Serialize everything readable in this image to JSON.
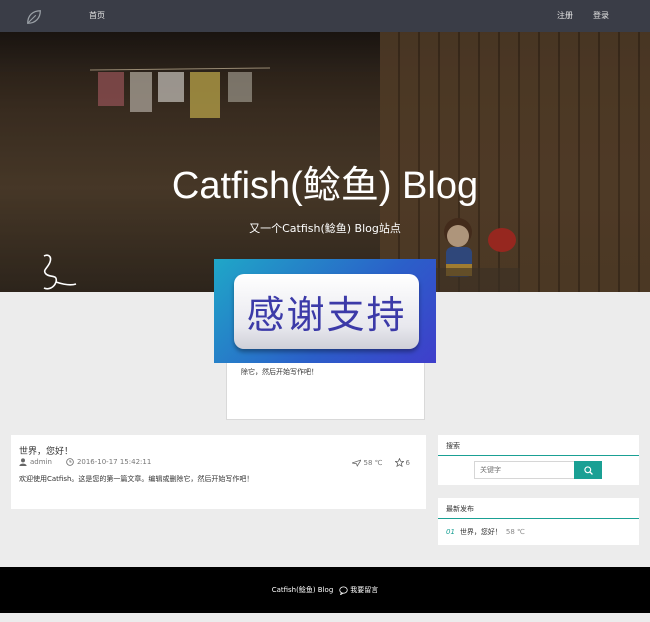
{
  "nav": {
    "home_label": "首页",
    "register_label": "注册",
    "login_label": "登录"
  },
  "hero": {
    "title": "Catfish(鲶鱼) Blog",
    "subtitle": "又一个Catfish(鲶鱼) Blog站点"
  },
  "banner": {
    "text": "感谢支持"
  },
  "popup": {
    "text": "除它，然后开始写作吧！"
  },
  "post": {
    "title": "世界，您好！",
    "author": "admin",
    "date": "2016-10-17 15:42:11",
    "views": "58 ℃",
    "favorites": "6",
    "excerpt": "欢迎使用Catfish。这是您的第一篇文章。编辑或删除它，然后开始写作吧！"
  },
  "search_widget": {
    "title": "搜索",
    "placeholder": "关键字"
  },
  "latest_widget": {
    "title": "最新发布",
    "items": [
      {
        "num": "01",
        "title": "世界，您好！",
        "views": "58 ℃"
      }
    ]
  },
  "footer": {
    "site_name": "Catfish(鲶鱼) Blog",
    "guestbook_label": "我要留言"
  },
  "colors": {
    "navbar": "#3a3d47",
    "accent": "#1aa094",
    "footer": "#000000",
    "page_bg": "#ececec"
  }
}
